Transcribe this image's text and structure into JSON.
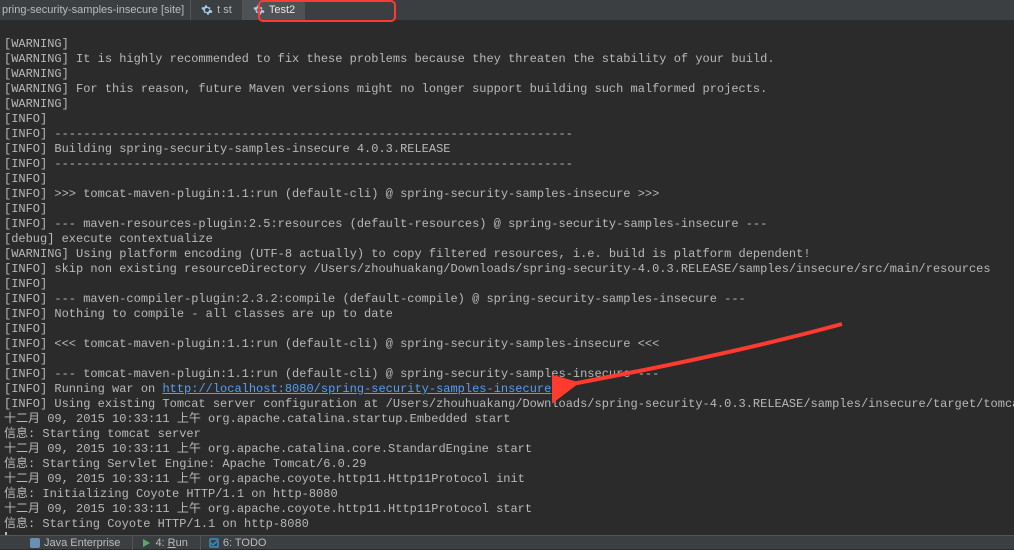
{
  "project_label": "pring-security-samples-insecure [site]",
  "tabs": [
    {
      "label": "t st",
      "active": false
    },
    {
      "label": "Test2",
      "active": true
    }
  ],
  "console_lines": [
    {
      "text": ""
    },
    {
      "text": "[WARNING]"
    },
    {
      "text": "[WARNING] It is highly recommended to fix these problems because they threaten the stability of your build."
    },
    {
      "text": "[WARNING]"
    },
    {
      "text": "[WARNING] For this reason, future Maven versions might no longer support building such malformed projects."
    },
    {
      "text": "[WARNING]"
    },
    {
      "text": "[INFO]"
    },
    {
      "text": "[INFO] ------------------------------------------------------------------------"
    },
    {
      "text": "[INFO] Building spring-security-samples-insecure 4.0.3.RELEASE"
    },
    {
      "text": "[INFO] ------------------------------------------------------------------------"
    },
    {
      "text": "[INFO]"
    },
    {
      "text": "[INFO] >>> tomcat-maven-plugin:1.1:run (default-cli) @ spring-security-samples-insecure >>>"
    },
    {
      "text": "[INFO]"
    },
    {
      "text": "[INFO] --- maven-resources-plugin:2.5:resources (default-resources) @ spring-security-samples-insecure ---"
    },
    {
      "text": "[debug] execute contextualize"
    },
    {
      "text": "[WARNING] Using platform encoding (UTF-8 actually) to copy filtered resources, i.e. build is platform dependent!"
    },
    {
      "text": "[INFO] skip non existing resourceDirectory /Users/zhouhuakang/Downloads/spring-security-4.0.3.RELEASE/samples/insecure/src/main/resources"
    },
    {
      "text": "[INFO]"
    },
    {
      "text": "[INFO] --- maven-compiler-plugin:2.3.2:compile (default-compile) @ spring-security-samples-insecure ---"
    },
    {
      "text": "[INFO] Nothing to compile - all classes are up to date"
    },
    {
      "text": "[INFO]"
    },
    {
      "text": "[INFO] <<< tomcat-maven-plugin:1.1:run (default-cli) @ spring-security-samples-insecure <<<"
    },
    {
      "text": "[INFO]"
    },
    {
      "text": "[INFO] --- tomcat-maven-plugin:1.1:run (default-cli) @ spring-security-samples-insecure ---"
    },
    {
      "pre": "[INFO] Running war on ",
      "link": "http://localhost:8080/spring-security-samples-insecure"
    },
    {
      "text": "[INFO] Using existing Tomcat server configuration at /Users/zhouhuakang/Downloads/spring-security-4.0.3.RELEASE/samples/insecure/target/tomcat"
    },
    {
      "text": "十二月 09, 2015 10:33:11 上午 org.apache.catalina.startup.Embedded start"
    },
    {
      "text": "信息: Starting tomcat server"
    },
    {
      "text": "十二月 09, 2015 10:33:11 上午 org.apache.catalina.core.StandardEngine start"
    },
    {
      "text": "信息: Starting Servlet Engine: Apache Tomcat/6.0.29"
    },
    {
      "text": "十二月 09, 2015 10:33:11 上午 org.apache.coyote.http11.Http11Protocol init"
    },
    {
      "text": "信息: Initializing Coyote HTTP/1.1 on http-8080"
    },
    {
      "text": "十二月 09, 2015 10:33:11 上午 org.apache.coyote.http11.Http11Protocol start"
    },
    {
      "text": "信息: Starting Coyote HTTP/1.1 on http-8080"
    },
    {
      "cursor": true
    }
  ],
  "bottom_tools": [
    {
      "icon": "java-icon",
      "label": "Java Enterprise"
    },
    {
      "icon": "run-icon",
      "pre": "4: ",
      "u": "R",
      "post": "un"
    },
    {
      "icon": "todo-icon",
      "label": "6: TODO"
    }
  ]
}
